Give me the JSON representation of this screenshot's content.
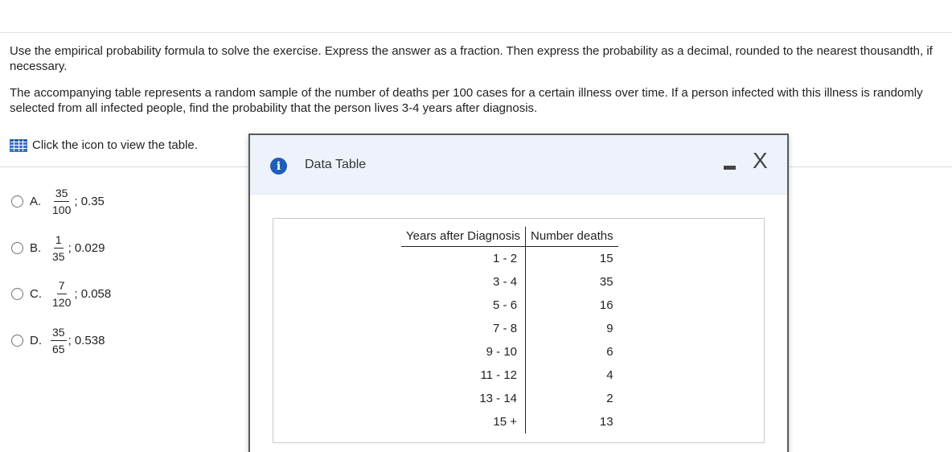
{
  "question": {
    "instruction": "Use the empirical probability formula to solve the exercise. Express the answer as a fraction. Then express the probability as a decimal, rounded to the nearest thousandth, if necessary.",
    "problem": "The accompanying table represents a random sample of the number of deaths per 100 cases for a certain illness over time. If a person infected with this illness is randomly selected from all infected people, find the probability that the person lives 3-4 years after diagnosis.",
    "table_link": "Click the icon to view the table."
  },
  "options": [
    {
      "letter": "A.",
      "num": "35",
      "den": "100",
      "rest": "; 0.35"
    },
    {
      "letter": "B.",
      "num": "1",
      "den": "35",
      "rest": "; 0.029"
    },
    {
      "letter": "C.",
      "num": "7",
      "den": "120",
      "rest": "; 0.058"
    },
    {
      "letter": "D.",
      "num": "35",
      "den": "65",
      "rest": "; 0.538"
    }
  ],
  "modal": {
    "title": "Data Table",
    "info_icon": "i",
    "close_icon": "X",
    "headers": [
      "Years after Diagnosis",
      "Number deaths"
    ],
    "rows": [
      [
        "1 - 2",
        "15"
      ],
      [
        "3 - 4",
        "35"
      ],
      [
        "5 - 6",
        "16"
      ],
      [
        "7 - 8",
        "9"
      ],
      [
        "9 - 10",
        "6"
      ],
      [
        "11 - 12",
        "4"
      ],
      [
        "13 - 14",
        "2"
      ],
      [
        "15 +",
        "13"
      ]
    ]
  }
}
